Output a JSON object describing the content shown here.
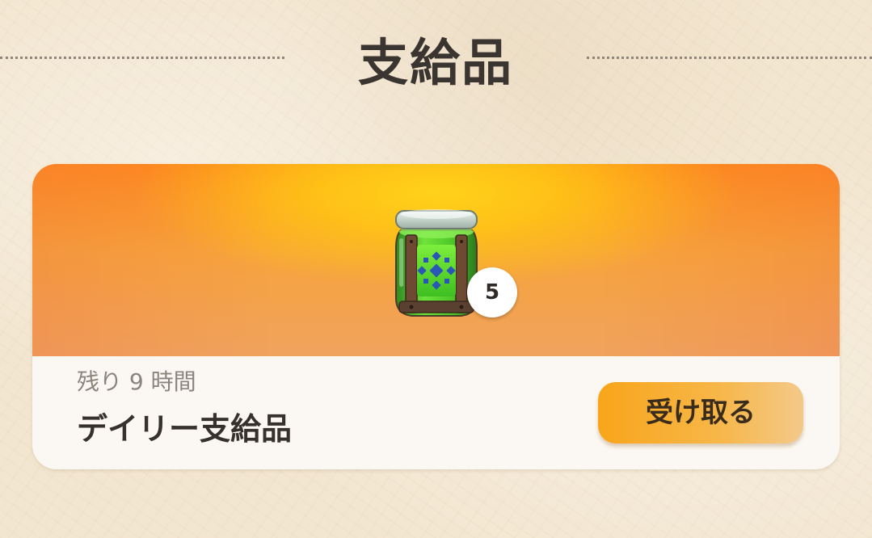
{
  "header": {
    "title": "支給品"
  },
  "supply_card": {
    "item_icon": "green-jar-icon",
    "item_count": "5",
    "time_remaining": "残り 9 時間",
    "name": "デイリー支給品",
    "receive_label": "受け取る"
  },
  "colors": {
    "background": "#f3e6d0",
    "banner_top": "#ff8a1c",
    "banner_center": "#ffd21a",
    "button": "#f8a51a",
    "title_text": "#3a3530"
  }
}
